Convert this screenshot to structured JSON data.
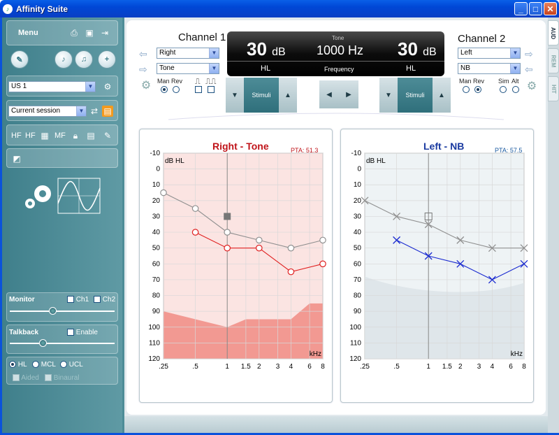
{
  "window": {
    "title": "Affinity Suite"
  },
  "sidebar": {
    "menu_label": "Menu",
    "patient_select": "US 1",
    "session_select": "Current session",
    "tools": [
      "HF",
      "HF",
      "MF"
    ],
    "monitor": {
      "label": "Monitor",
      "ch1": "Ch1",
      "ch2": "Ch2",
      "level": 0.42
    },
    "talkback": {
      "label": "Talkback",
      "enable": "Enable",
      "level": 0.33
    },
    "modes": {
      "hl": "HL",
      "mcl": "MCL",
      "ucl": "UCL",
      "aided": "Aided",
      "binaural": "Binaural"
    }
  },
  "channel1": {
    "title": "Channel 1",
    "output_select": "Right",
    "stim_select": "Tone",
    "man_rev": "Man Rev",
    "level": "30",
    "unit": "dB",
    "level_label": "HL"
  },
  "channel2": {
    "title": "Channel 2",
    "output_select": "Left",
    "stim_select": "NB",
    "man_rev": "Man Rev",
    "sim": "Sim",
    "alt": "Alt",
    "level": "30",
    "unit": "dB",
    "level_label": "HL"
  },
  "display": {
    "top_label": "Tone",
    "frequency": "1000 Hz",
    "freq_label": "Frequency"
  },
  "stimuli_label": "Stimuli",
  "tabs": [
    "AUD",
    "REM",
    "HIT"
  ],
  "graph_right": {
    "title": "Right - Tone",
    "pta": "PTA: 51.3",
    "ylabel": "dB HL",
    "xunit": "kHz"
  },
  "graph_left": {
    "title": "Left - NB",
    "pta": "PTA: 57.5",
    "ylabel": "dB HL",
    "xunit": "kHz"
  },
  "axis": {
    "y_ticks": [
      "-10",
      "0",
      "10",
      "20",
      "30",
      "40",
      "50",
      "60",
      "70",
      "80",
      "90",
      "100",
      "110",
      "120"
    ],
    "x_ticks": [
      ".25",
      ".5",
      "1",
      "1.5",
      "2",
      "3",
      "4",
      "6",
      "8"
    ]
  },
  "chart_data": [
    {
      "type": "line",
      "title": "Right - Tone",
      "ylabel": "dB HL",
      "xlabel": "kHz",
      "ylim": [
        -10,
        120
      ],
      "y_inverted": true,
      "x_categories": [
        ".25",
        ".5",
        "1",
        "1.5",
        "2",
        "3",
        "4",
        "6",
        "8"
      ],
      "series": [
        {
          "color": "#909090",
          "points": [
            [
              ".25",
              15
            ],
            [
              ".5",
              25
            ],
            [
              "1",
              40
            ],
            [
              "2",
              45
            ],
            [
              "4",
              50
            ],
            [
              "8",
              45
            ]
          ]
        },
        {
          "color": "#e02020",
          "points": [
            [
              ".5",
              40
            ],
            [
              "1",
              50
            ],
            [
              "2",
              50
            ],
            [
              "4",
              65
            ],
            [
              "8",
              60
            ]
          ]
        }
      ]
    },
    {
      "type": "line",
      "title": "Left - NB",
      "ylabel": "dB HL",
      "xlabel": "kHz",
      "ylim": [
        -10,
        120
      ],
      "y_inverted": true,
      "x_categories": [
        ".25",
        ".5",
        "1",
        "1.5",
        "2",
        "3",
        "4",
        "6",
        "8"
      ],
      "series": [
        {
          "color": "#909090",
          "points": [
            [
              ".25",
              20
            ],
            [
              ".5",
              30
            ],
            [
              "1",
              35
            ],
            [
              "2",
              45
            ],
            [
              "4",
              50
            ],
            [
              "8",
              50
            ]
          ]
        },
        {
          "color": "#1a2ad0",
          "points": [
            [
              ".5",
              45
            ],
            [
              "1",
              55
            ],
            [
              "2",
              60
            ],
            [
              "4",
              70
            ],
            [
              "8",
              60
            ]
          ]
        }
      ]
    }
  ]
}
